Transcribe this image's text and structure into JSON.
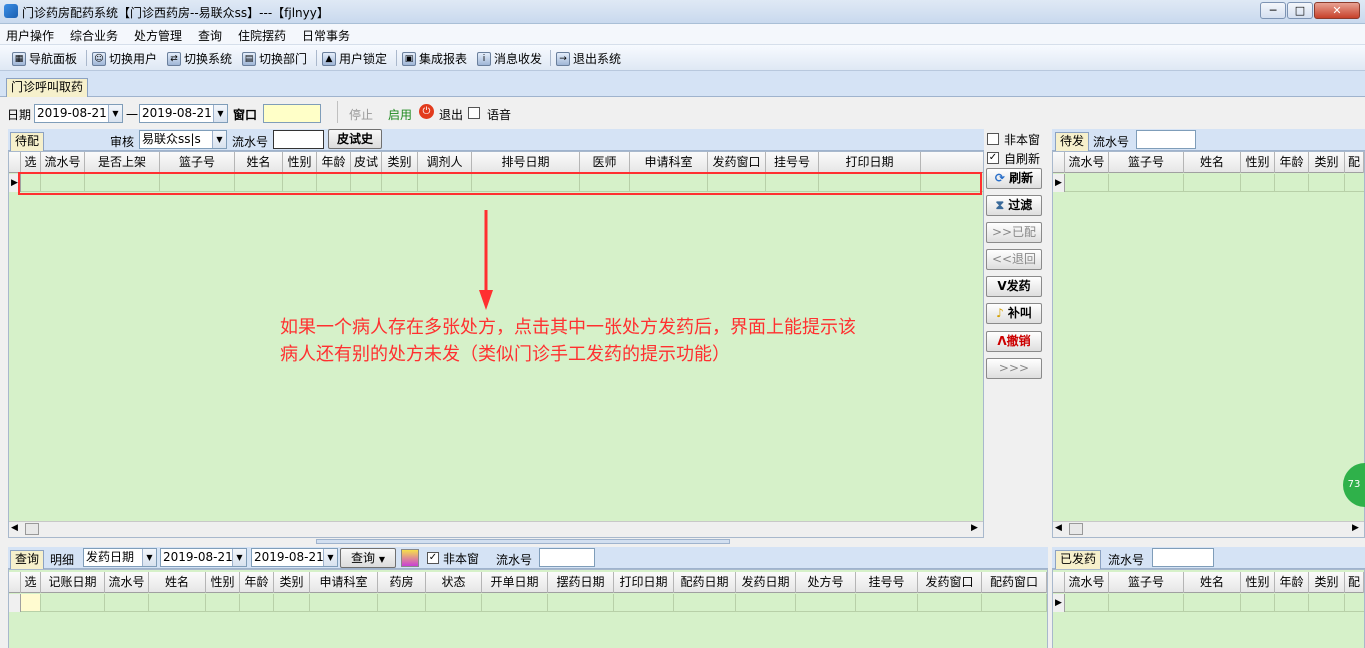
{
  "window": {
    "title": "门诊药房配药系统【门诊西药房--易联众ss】---【fjlnyy】",
    "min": "─",
    "max": "□",
    "close": "✕"
  },
  "menu": [
    "用户操作",
    "综合业务",
    "处方管理",
    "查询",
    "住院摆药",
    "日常事务"
  ],
  "toolbar": {
    "items": [
      {
        "label": "导航面板",
        "icon": "navigation-panel-icon"
      },
      {
        "label": "切换用户",
        "icon": "switch-user-icon"
      },
      {
        "label": "切换系统",
        "icon": "switch-system-icon"
      },
      {
        "label": "切换部门",
        "icon": "switch-department-icon"
      },
      {
        "label": "用户锁定",
        "icon": "user-lock-icon"
      },
      {
        "label": "集成报表",
        "icon": "report-icon"
      },
      {
        "label": "消息收发",
        "icon": "message-icon"
      },
      {
        "label": "退出系统",
        "icon": "exit-system-icon"
      }
    ]
  },
  "main_tab": "门诊呼叫取药",
  "filter": {
    "date_label": "日期",
    "date_from": "2019-08-21",
    "dash": "一",
    "date_to": "2019-08-21",
    "window_label": "窗口",
    "window_value": "",
    "stop_label": "停止",
    "enable_label": "启用",
    "exit_label": "退出",
    "voice_label": "语音"
  },
  "pending": {
    "tab": "待配",
    "review_label": "审核",
    "reviewer": "易联众ss|s",
    "serial_label": "流水号",
    "serial_value": "",
    "skin_test_btn": "皮试史",
    "columns": [
      "选",
      "流水号",
      "是否上架",
      "篮子号",
      "姓名",
      "性别",
      "年龄",
      "皮试",
      "类别",
      "调剂人",
      "排号日期",
      "医师",
      "申请科室",
      "发药窗口",
      "挂号号",
      "打印日期"
    ]
  },
  "side": {
    "not_this_window": "非本窗",
    "not_this_window_checked": false,
    "auto_refresh": "自刷新",
    "auto_refresh_checked": true,
    "buttons": [
      {
        "label": "刷新",
        "icon": "refresh-icon",
        "enabled": true
      },
      {
        "label": "过滤",
        "icon": "filter-icon",
        "enabled": true
      },
      {
        "label": ">>已配",
        "icon": "",
        "enabled": false
      },
      {
        "label": "<<退回",
        "icon": "",
        "enabled": false
      },
      {
        "label": "V发药",
        "icon": "",
        "enabled": true
      },
      {
        "label": "补叫",
        "icon": "bell-icon",
        "enabled": true
      },
      {
        "label": "Λ撤销",
        "icon": "",
        "enabled": true,
        "color": "#cc0000"
      },
      {
        "label": ">>>",
        "icon": "",
        "enabled": false
      }
    ]
  },
  "waiting": {
    "tab": "待发",
    "serial_label": "流水号",
    "serial_value": "",
    "columns": [
      "流水号",
      "篮子号",
      "姓名",
      "性别",
      "年龄",
      "类别",
      "配"
    ]
  },
  "annotation": {
    "line1": "如果一个病人存在多张处方，点击其中一张处方发药后，界面上能提示该",
    "line2": "病人还有别的处方未发（类似门诊手工发药的提示功能）",
    "color": "#ff3030"
  },
  "query": {
    "tab_query": "查询",
    "tab_detail": "明细",
    "date_type": "发药日期",
    "date_from": "2019-08-21",
    "date_to": "2019-08-21",
    "query_btn": "查询",
    "not_this_window": "非本窗",
    "not_this_window_checked": true,
    "serial_label": "流水号",
    "serial_value": "",
    "columns": [
      "选",
      "记账日期",
      "流水号",
      "姓名",
      "性别",
      "年龄",
      "类别",
      "申请科室",
      "药房",
      "状态",
      "开单日期",
      "摆药日期",
      "打印日期",
      "配药日期",
      "发药日期",
      "处方号",
      "挂号号",
      "发药窗口",
      "配药窗口"
    ]
  },
  "dispensed": {
    "tab": "已发药",
    "serial_label": "流水号",
    "serial_value": "",
    "columns": [
      "流水号",
      "篮子号",
      "姓名",
      "性别",
      "年龄",
      "类别",
      "配"
    ]
  },
  "badge": "73"
}
